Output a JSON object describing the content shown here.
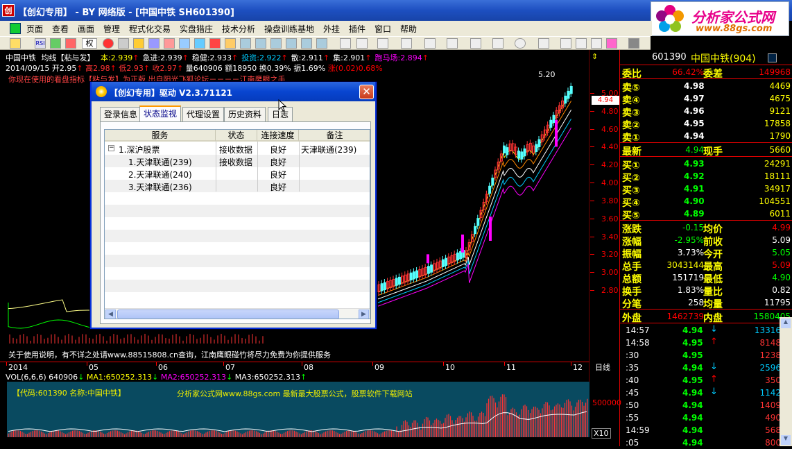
{
  "window": {
    "title": "【创幻专用】 - BY 网络版 - [中国中铁 SH601390]",
    "app_icon_text": "创"
  },
  "logo": {
    "main": "分析家公式网",
    "url": "www.88gs.com"
  },
  "menu": [
    "页面",
    "查看",
    "画面",
    "管理",
    "程式化交易",
    "实盘猎庄",
    "技术分析",
    "操盘训练基地",
    "外挂",
    "插件",
    "窗口",
    "帮助"
  ],
  "toolbar": {
    "period_label": "权"
  },
  "stock_header": {
    "name": "中国中铁",
    "indicator": "均线【粘与发】",
    "items": [
      {
        "label": "本:",
        "value": "2.939",
        "color": "#ff0"
      },
      {
        "label": "急进:",
        "value": "2.939",
        "color": "#fff"
      },
      {
        "label": "稳健:",
        "value": "2.933",
        "color": "#fff"
      },
      {
        "label": "投资:",
        "value": "2.922",
        "color": "#0cf"
      },
      {
        "label": "散:",
        "value": "2.911",
        "color": "#fff"
      },
      {
        "label": "集:",
        "value": "2.901",
        "color": "#fff"
      },
      {
        "label": "跑马场:",
        "value": "2.894",
        "color": "#f0f"
      }
    ]
  },
  "quote_header": {
    "date": "2014/09/15",
    "open": "开2.95",
    "high": "高2.98",
    "low": "低2.93",
    "close": "收2.97",
    "volume": "量640906",
    "turnover": "额18950",
    "change_rate": "换0.39%",
    "amplitude": "振1.69%",
    "rise": "涨(0.02)0.68%"
  },
  "warning": "你现在使用的看盘指标【粘与发】为正版         出自阳光飞狐论坛－－－－江南鹰眼之手",
  "help_line": "关于使用说明，有不详之处请www.88515808.cn查询，江南鹰眼碰竹将尽力免费为你提供服务",
  "price_chart": {
    "top_label": "5.20",
    "price_axis": [
      "5.00",
      "4.80",
      "4.60",
      "4.40",
      "4.20",
      "4.00",
      "3.80",
      "3.60",
      "3.40",
      "3.20",
      "3.00",
      "2.80"
    ],
    "last_price_tag": "4.94",
    "dates": [
      "2014",
      "05",
      "06",
      "07",
      "08",
      "09",
      "10",
      "11",
      "12"
    ],
    "period_mode": "日线"
  },
  "volume_panel": {
    "header": "VOL(6,6,6) 640906",
    "ma1": "MA1:650252.313",
    "ma2": "MA2:650252.313",
    "ma3": "MA3:650252.313",
    "code_label": "【代码:601390 名称:中国中铁】",
    "ad": "分析家公式网www.88gs.com 最新最大股票公式，股票软件下载网站",
    "scale_label": "500000",
    "multiplier": "X10"
  },
  "quote_panel": {
    "code": "601390",
    "name": "中国中铁(904)",
    "ratio": {
      "l1": "委比",
      "v1": "66.42%",
      "l2": "委差",
      "v2": "149968"
    },
    "asks": [
      {
        "label": "卖⑤",
        "price": "4.98",
        "vol": "4469"
      },
      {
        "label": "卖④",
        "price": "4.97",
        "vol": "4675"
      },
      {
        "label": "卖③",
        "price": "4.96",
        "vol": "9121"
      },
      {
        "label": "卖②",
        "price": "4.95",
        "vol": "17858"
      },
      {
        "label": "卖①",
        "price": "4.94",
        "vol": "1790"
      }
    ],
    "last": {
      "l1": "最新",
      "v1": "4.94",
      "l2": "现手",
      "v2": "5660"
    },
    "bids": [
      {
        "label": "买①",
        "price": "4.93",
        "vol": "24291"
      },
      {
        "label": "买②",
        "price": "4.92",
        "vol": "18111"
      },
      {
        "label": "买③",
        "price": "4.91",
        "vol": "34917"
      },
      {
        "label": "买④",
        "price": "4.90",
        "vol": "104551"
      },
      {
        "label": "买⑤",
        "price": "4.89",
        "vol": "6011"
      }
    ],
    "stats": [
      {
        "l1": "涨跌",
        "v1": "-0.15",
        "l2": "均价",
        "v2": "4.99"
      },
      {
        "l1": "涨幅",
        "v1": "-2.95%",
        "l2": "前收",
        "v2": "5.09"
      },
      {
        "l1": "振幅",
        "v1": "3.73%",
        "l2": "今开",
        "v2": "5.05"
      },
      {
        "l1": "总手",
        "v1": "3043144",
        "l2": "最高",
        "v2": "5.09"
      },
      {
        "l1": "总额",
        "v1": "151719",
        "l2": "最低",
        "v2": "4.90"
      },
      {
        "l1": "换手",
        "v1": "1.83%",
        "l2": "量比",
        "v2": "0.82"
      },
      {
        "l1": "分笔",
        "v1": "258",
        "l2": "均量",
        "v2": "11795"
      }
    ],
    "outer_inner": {
      "l1": "外盘",
      "v1": "1462739",
      "l2": "内盘",
      "v2": "1580405"
    },
    "ticks": [
      {
        "time": "14:57",
        "price": "4.94",
        "dir": "down",
        "vol": "13316"
      },
      {
        "time": "14:58",
        "price": "4.95",
        "dir": "up",
        "vol": "8148"
      },
      {
        "time": ":30",
        "price": "4.95",
        "dir": "",
        "vol": "1238"
      },
      {
        "time": ":35",
        "price": "4.94",
        "dir": "down",
        "vol": "2596"
      },
      {
        "time": ":40",
        "price": "4.95",
        "dir": "up",
        "vol": "350"
      },
      {
        "time": ":45",
        "price": "4.94",
        "dir": "down",
        "vol": "1142"
      },
      {
        "time": ":50",
        "price": "4.94",
        "dir": "",
        "vol": "1409"
      },
      {
        "time": ":55",
        "price": "4.94",
        "dir": "",
        "vol": "490"
      },
      {
        "time": "14:59",
        "price": "4.94",
        "dir": "",
        "vol": "568"
      },
      {
        "time": ":05",
        "price": "4.94",
        "dir": "",
        "vol": "800"
      }
    ]
  },
  "dialog": {
    "title": "【创幻专用】驱动 V2.3.71121",
    "tabs": [
      "登录信息",
      "状态监视",
      "代理设置",
      "历史资料",
      "日志"
    ],
    "active_tab": 1,
    "columns": [
      "服务",
      "状态",
      "连接速度",
      "备注"
    ],
    "rows": [
      {
        "service": "1.深沪股票",
        "status": "接收数据",
        "speed": "良好",
        "note": "天津联通(239)"
      },
      {
        "service": "1.天津联通(239)",
        "status": "接收数据",
        "speed": "良好",
        "note": ""
      },
      {
        "service": "2.天津联通(240)",
        "status": "",
        "speed": "良好",
        "note": ""
      },
      {
        "service": "3.天津联通(236)",
        "status": "",
        "speed": "良好",
        "note": ""
      }
    ]
  }
}
